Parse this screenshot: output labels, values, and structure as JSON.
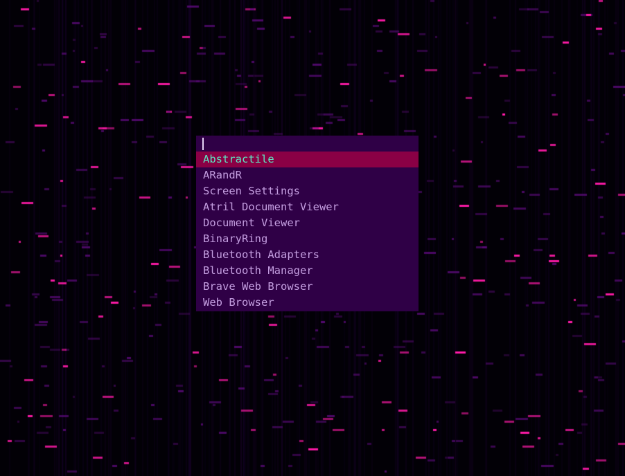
{
  "theme": {
    "background": "#000000",
    "wallpaper_accent": "#ff1aa8",
    "wallpaper_dim": "#5a0a78",
    "launcher_bg": "#2f0046",
    "selected_bg": "#8a0045",
    "selected_fg": "#5ee6c3",
    "item_fg": "#c49ee0"
  },
  "launcher": {
    "query": "",
    "selected_index": 0,
    "items": [
      {
        "label": "Abstractile"
      },
      {
        "label": "ARandR"
      },
      {
        "label": "Screen Settings"
      },
      {
        "label": "Atril Document Viewer"
      },
      {
        "label": "Document Viewer"
      },
      {
        "label": "BinaryRing"
      },
      {
        "label": "Bluetooth Adapters"
      },
      {
        "label": "Bluetooth Manager"
      },
      {
        "label": "Brave Web Browser"
      },
      {
        "label": "Web Browser"
      }
    ]
  }
}
